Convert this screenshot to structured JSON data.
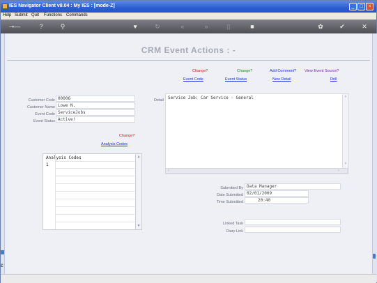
{
  "window": {
    "title": "IES Navigator Client v8.04 : My IES :        [mode-Z]"
  },
  "menu": [
    "Help",
    "Submit",
    "Quit",
    "Functions",
    "Commands"
  ],
  "page": {
    "title": "CRM Event Actions : -"
  },
  "actions": {
    "change1": "Change?",
    "change2": "Change?",
    "add_comment": "Add Comment?",
    "view_source": "View Event Source?",
    "event_code": "Event Code",
    "event_status": "Event Status",
    "new_detail": "New Detail",
    "drill": "Drill"
  },
  "customer": {
    "code_label": "Customer Code",
    "code": "00006",
    "name_label": "Customer Name",
    "name": "Lowe N.",
    "event_code_label": "Event Code",
    "event_code": "ServiceJobs",
    "event_status_label": "Event Status",
    "event_status": "Active!"
  },
  "analysis": {
    "change": "Change?",
    "link": "Analysis Codes",
    "header": "Analysis Codes",
    "row1": "1"
  },
  "detail": {
    "label": "Detail",
    "text": "Service Job: Car Service - General"
  },
  "submission": {
    "by_label": "Submitted By",
    "by": "Data Manager",
    "date_label": "Date Submitted",
    "date": "02/01/2009",
    "time_label": "Time Submitted",
    "time": "20:40"
  },
  "links": {
    "task_label": "Linked Task",
    "task": "",
    "diary_label": "Diary Link",
    "diary": ""
  },
  "colors": {
    "red": "#cc1f1f",
    "green": "#1f8a1f",
    "navy": "#1c2fd8",
    "purple": "#7a23a8",
    "title_bar": "#2b5fd0"
  }
}
